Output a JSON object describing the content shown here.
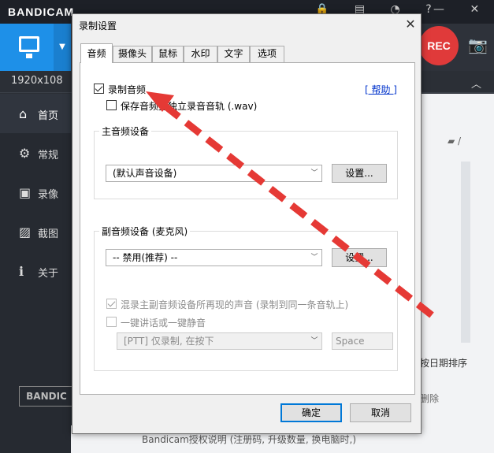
{
  "background_app": {
    "logo": "BANDICAM",
    "top_icons": "🔒 ▤ ◔ ?",
    "window_buttons": "— ✕",
    "rec_label": "REC",
    "resolution": "1920x108",
    "sidebar": [
      {
        "icon": "⌂",
        "label": "首页"
      },
      {
        "icon": "⚙",
        "label": "常规"
      },
      {
        "icon": "▣",
        "label": "录像"
      },
      {
        "icon": "▨",
        "label": "截图"
      },
      {
        "icon": "ℹ",
        "label": "关于"
      }
    ],
    "bandicam_button": "BANDIC",
    "sort_label": "按日期排序",
    "delete_label": "删除",
    "folder_label": "▰ /",
    "footer_text": "Bandicam授权说明 (注册码, 升级数量, 换电脑时,)"
  },
  "dialog": {
    "title": "录制设置",
    "close": "✕",
    "tabs": [
      "音频",
      "摄像头",
      "鼠标",
      "水印",
      "文字",
      "选项"
    ],
    "active_tab_index": 0,
    "record_audio": {
      "label": "录制音频",
      "checked": true
    },
    "save_separate": {
      "label": "保存音频至独立录音音轨 (.wav)",
      "checked": false
    },
    "help_link": "[ 帮助 ]",
    "primary_device": {
      "group_title": "主音频设备",
      "selected": "(默认声音设备)",
      "settings_button": "设置..."
    },
    "secondary_device": {
      "group_title": "副音频设备 (麦克风)",
      "selected": "-- 禁用(推荐) --",
      "settings_button": "设置...",
      "mix_option": {
        "label": "混录主副音频设备所再现的声音 (录制到同一条音轨上)",
        "checked": true,
        "disabled": true
      },
      "ptt_option": {
        "label": "一键讲话或一键静音",
        "checked": false,
        "disabled": true
      },
      "ptt_mode": "[PTT] 仅录制, 在按下",
      "ptt_key": "Space"
    },
    "ok_button": "确定",
    "cancel_button": "取消"
  },
  "colors": {
    "accent_blue": "#1e90e8",
    "rec_red": "#e03a3a",
    "arrow_red": "#e53935"
  }
}
